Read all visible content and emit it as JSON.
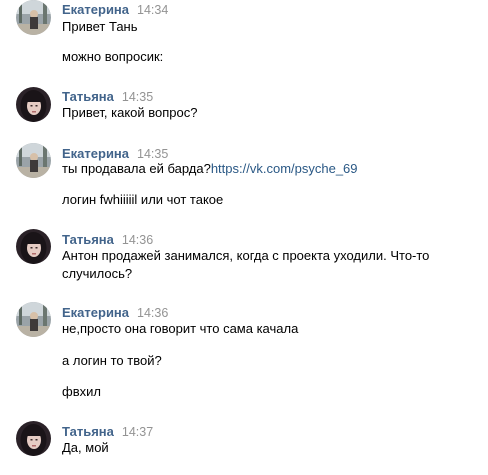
{
  "messages": [
    {
      "author": "Екатерина",
      "time": "14:34",
      "lines": [
        "Привет Тань",
        "можно вопросик:"
      ]
    },
    {
      "author": "Татьяна",
      "time": "14:35",
      "lines": [
        "Привет, какой вопрос?"
      ]
    },
    {
      "author": "Екатерина",
      "time": "14:35",
      "line1_text": "ты продавала ей барда?",
      "line1_link": "https://vk.com/psyche_69",
      "lines": [
        "логин fwhiiiiil или чот такое"
      ]
    },
    {
      "author": "Татьяна",
      "time": "14:36",
      "lines": [
        "Антон продажей занимался, когда с проекта уходили. Что-то",
        "случилось?"
      ]
    },
    {
      "author": "Екатерина",
      "time": "14:36",
      "lines": [
        "не,просто она говорит что сама качала",
        "а логин то твой?",
        "фвхил"
      ]
    },
    {
      "author": "Татьяна",
      "time": "14:37",
      "lines": [
        "Да, мой"
      ]
    }
  ],
  "colors": {
    "author_name": "#42648b",
    "timestamp": "#939393",
    "link": "#2a5885"
  }
}
